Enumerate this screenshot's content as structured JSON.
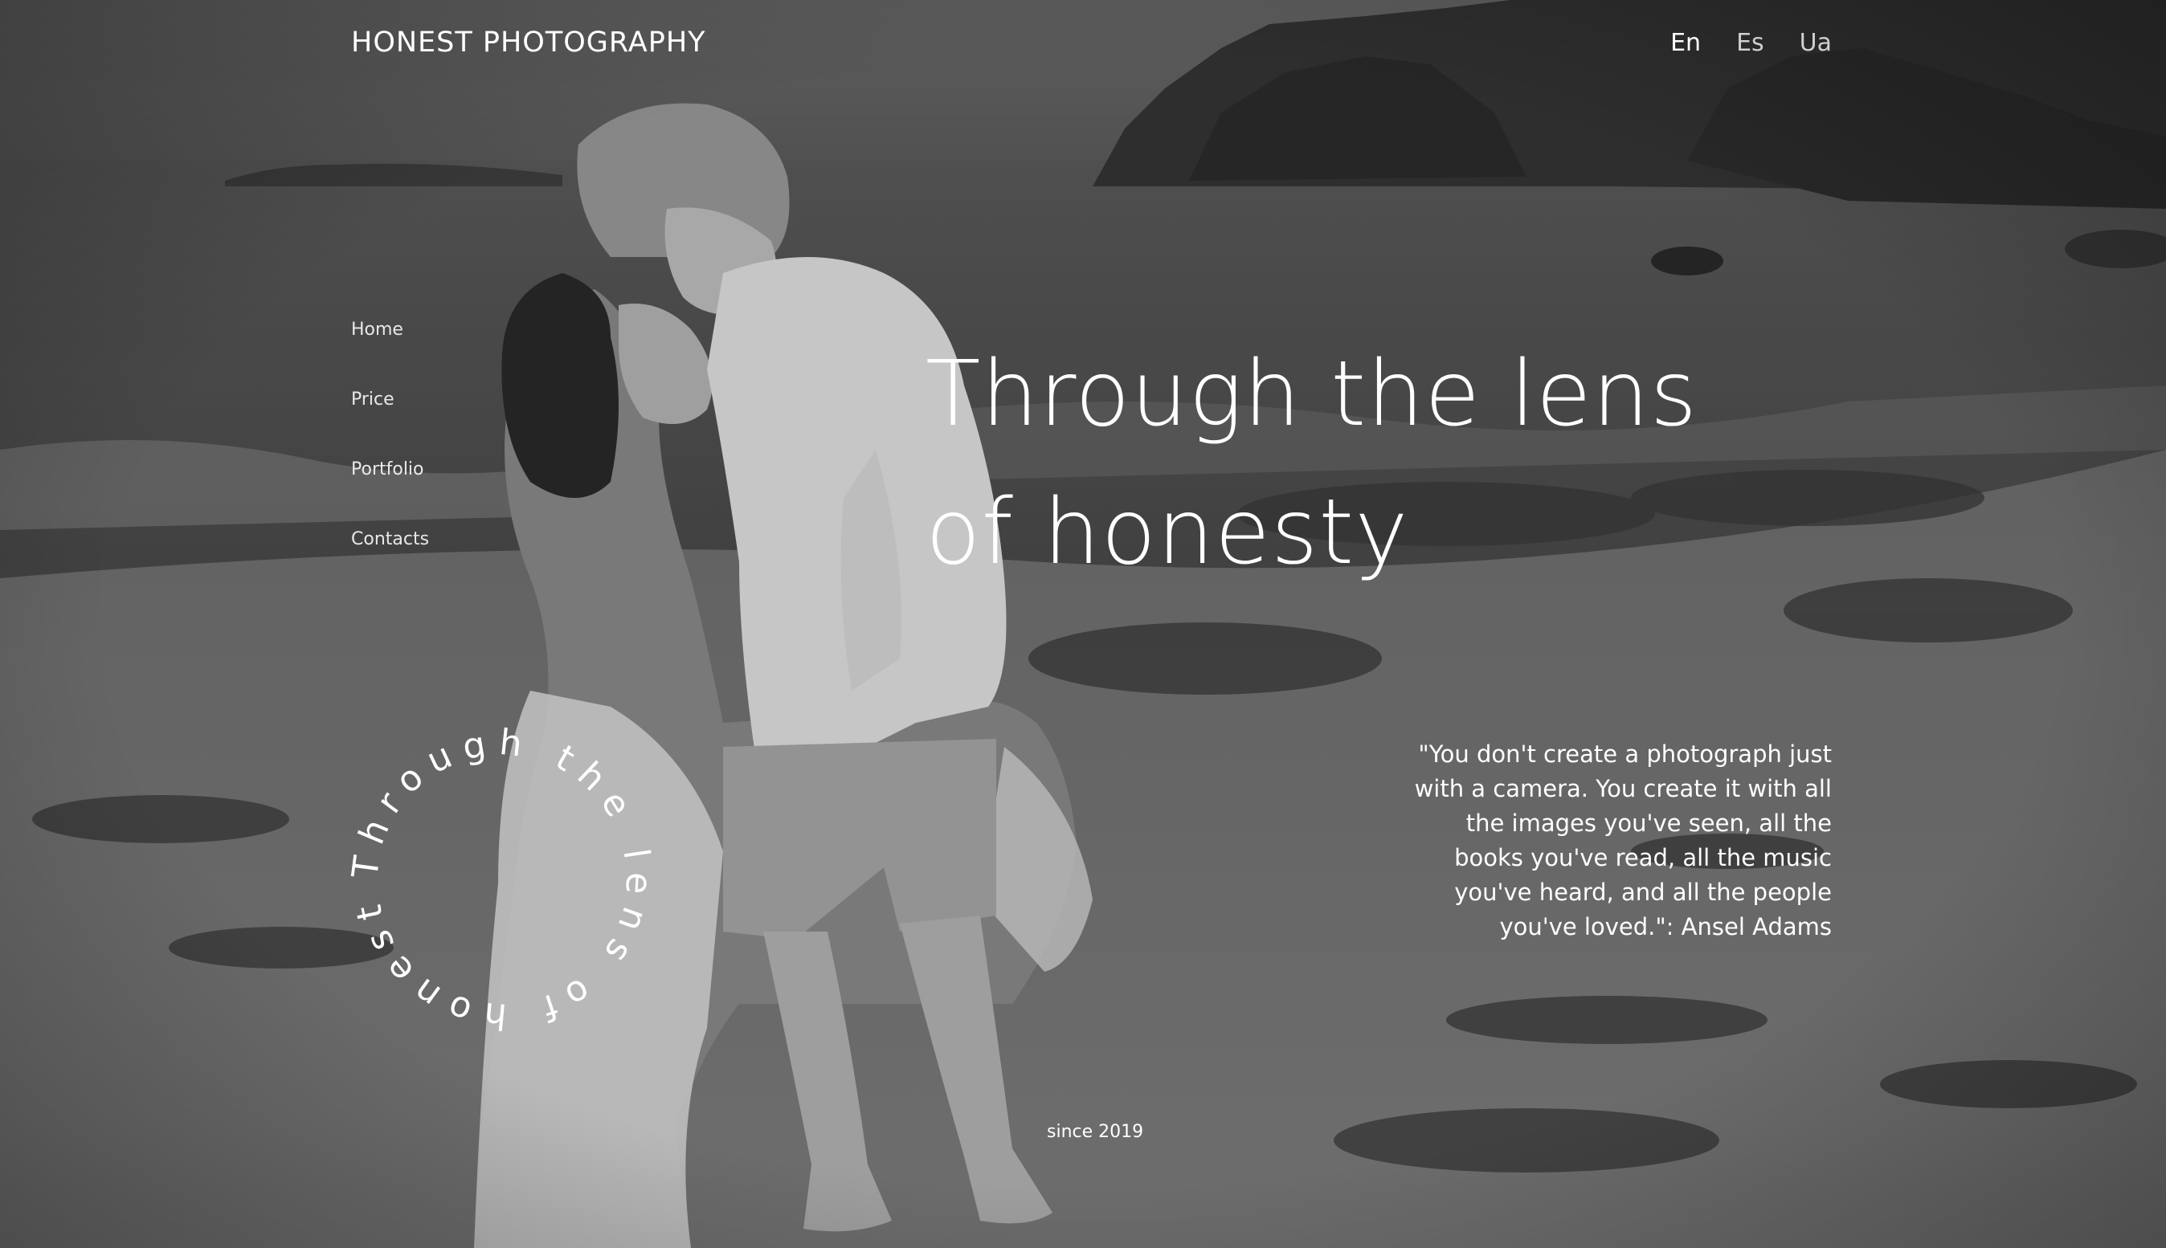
{
  "header": {
    "brand": "HONEST PHOTOGRAPHY",
    "languages": [
      {
        "label": "En",
        "active": true
      },
      {
        "label": "Es",
        "active": false
      },
      {
        "label": "Ua",
        "active": false
      }
    ]
  },
  "nav": {
    "items": [
      "Home",
      "Price",
      "Portfolio",
      "Contacts"
    ]
  },
  "hero": {
    "title_line1": "Through the lens",
    "title_line2": "of honesty",
    "circular_text": "Through the lens of honesty"
  },
  "quote": {
    "text": "\"You don't create a photograph just with a camera. You create it with all the images you've seen, all the books you've read, all the music you've heard, and all the people you've loved.\": Ansel Adams"
  },
  "footer": {
    "since": "since 2019"
  },
  "colors": {
    "text": "#ffffff",
    "inactive_lang": "#cfcfcf",
    "photo_tint": "grayscale"
  }
}
